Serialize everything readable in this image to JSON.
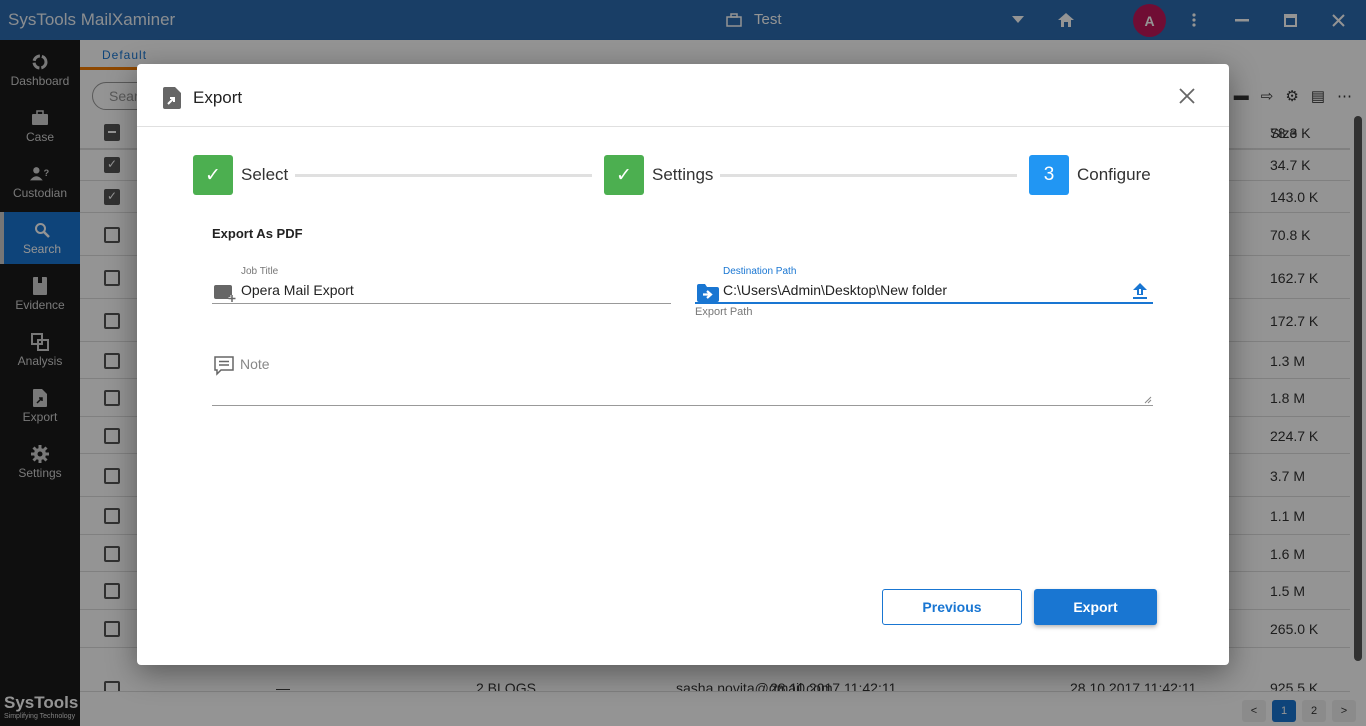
{
  "titlebar": {
    "app_title": "SysTools MailXaminer",
    "case_name": "Test",
    "avatar_initial": "A"
  },
  "sidebar": {
    "items": [
      {
        "label": "Dashboard",
        "icon": "dashboard-icon"
      },
      {
        "label": "Case",
        "icon": "briefcase-icon"
      },
      {
        "label": "Custodian",
        "icon": "custodian-icon"
      },
      {
        "label": "Search",
        "icon": "search-icon",
        "active": true
      },
      {
        "label": "Evidence",
        "icon": "evidence-icon"
      },
      {
        "label": "Analysis",
        "icon": "analysis-icon"
      },
      {
        "label": "Export",
        "icon": "export-icon"
      },
      {
        "label": "Settings",
        "icon": "gear-icon"
      }
    ],
    "brand_name": "SysTools",
    "brand_tagline": "Simplifying Technology"
  },
  "main": {
    "tab_label": "Default",
    "search_placeholder": "Search",
    "size_header": "Size",
    "rows": [
      {
        "size": "78.3 K",
        "checked": false
      },
      {
        "size": "34.7 K",
        "checked": true
      },
      {
        "size": "143.0 K",
        "checked": true
      },
      {
        "size": "70.8 K",
        "checked": false
      },
      {
        "size": "162.7 K",
        "checked": false
      },
      {
        "size": "172.7 K",
        "checked": false
      },
      {
        "size": "1.3 M",
        "checked": false
      },
      {
        "size": "1.8 M",
        "checked": false
      },
      {
        "size": "224.7 K",
        "checked": false
      },
      {
        "size": "3.7 M",
        "checked": false
      },
      {
        "size": "1.1 M",
        "checked": false
      },
      {
        "size": "1.6 M",
        "checked": false
      },
      {
        "size": "1.5 M",
        "checked": false
      },
      {
        "size": "265.0 K",
        "checked": false
      }
    ],
    "partial_row": {
      "c1": "—",
      "c2": "2 BLOGS",
      "c3": "sasha.novita@gmail.com",
      "c4": "28.10.2017 11:42:11",
      "c5": "28.10.2017 11:42:11",
      "size": "925.5 K"
    },
    "pager": {
      "prev": "<",
      "pages": [
        "1",
        "2"
      ],
      "current": "1",
      "next": ">"
    }
  },
  "dialog": {
    "title": "Export",
    "steps": [
      {
        "label": "Select",
        "state": "done",
        "marker": "✓"
      },
      {
        "label": "Settings",
        "state": "done",
        "marker": "✓"
      },
      {
        "label": "Configure",
        "state": "current",
        "marker": "3"
      }
    ],
    "section_title": "Export As PDF",
    "job_title": {
      "label": "Job Title",
      "value": "Opera Mail Export"
    },
    "destination": {
      "label": "Destination Path",
      "value": "C:\\Users\\Admin\\Desktop\\New folder",
      "hint": "Export Path"
    },
    "note": {
      "placeholder": "Note",
      "value": ""
    },
    "buttons": {
      "previous": "Previous",
      "export": "Export"
    },
    "accent_color": "#1976d2",
    "done_color": "#4caf50",
    "current_color": "#2196f3"
  }
}
